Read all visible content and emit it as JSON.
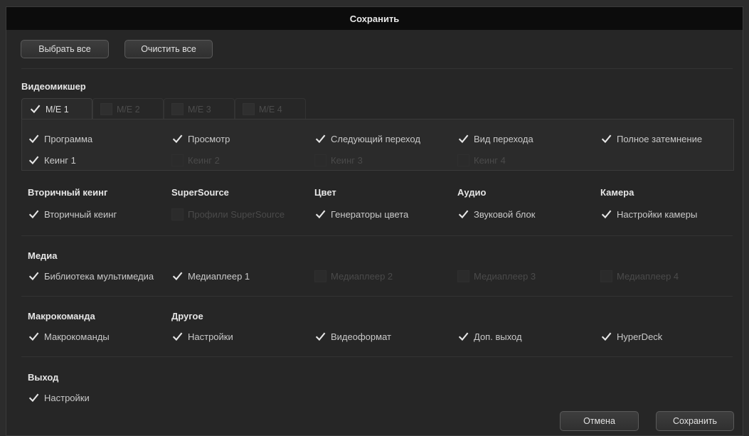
{
  "dialog": {
    "title": "Сохранить"
  },
  "toolbar": {
    "select_all": "Выбрать все",
    "clear_all": "Очистить все"
  },
  "switcher": {
    "title": "Видеомикшер",
    "tabs": [
      {
        "label": "M/E 1",
        "checked": true,
        "active": true
      },
      {
        "label": "M/E 2",
        "checked": false,
        "active": false
      },
      {
        "label": "M/E 3",
        "checked": false,
        "active": false
      },
      {
        "label": "M/E 4",
        "checked": false,
        "active": false
      }
    ],
    "items": [
      {
        "label": "Программа",
        "checked": true
      },
      {
        "label": "Просмотр",
        "checked": true
      },
      {
        "label": "Следующий переход",
        "checked": true
      },
      {
        "label": "Вид перехода",
        "checked": true
      },
      {
        "label": "Полное затемнение",
        "checked": true
      },
      {
        "label": "Кеинг 1",
        "checked": true
      },
      {
        "label": "Кеинг 2",
        "checked": false
      },
      {
        "label": "Кеинг 3",
        "checked": false
      },
      {
        "label": "Кеинг 4",
        "checked": false
      }
    ]
  },
  "groups": {
    "downstream_key": {
      "title": "Вторичный кеинг",
      "item": {
        "label": "Вторичный кеинг",
        "checked": true
      }
    },
    "supersource": {
      "title": "SuperSource",
      "item": {
        "label": "Профили SuperSource",
        "checked": false
      }
    },
    "color": {
      "title": "Цвет",
      "item": {
        "label": "Генераторы цвета",
        "checked": true
      }
    },
    "audio": {
      "title": "Аудио",
      "item": {
        "label": "Звуковой блок",
        "checked": true
      }
    },
    "camera": {
      "title": "Камера",
      "item": {
        "label": "Настройки камеры",
        "checked": true
      }
    }
  },
  "media": {
    "title": "Медиа",
    "items": [
      {
        "label": "Библиотека мультимедиа",
        "checked": true
      },
      {
        "label": "Медиаплеер 1",
        "checked": true
      },
      {
        "label": "Медиаплеер 2",
        "checked": false
      },
      {
        "label": "Медиаплеер 3",
        "checked": false
      },
      {
        "label": "Медиаплеер 4",
        "checked": false
      }
    ]
  },
  "macro": {
    "title": "Макрокоманда",
    "item": {
      "label": "Макрокоманды",
      "checked": true
    }
  },
  "other": {
    "title": "Другое",
    "items": [
      {
        "label": "Настройки",
        "checked": true
      },
      {
        "label": "Видеоформат",
        "checked": true
      },
      {
        "label": "Доп. выход",
        "checked": true
      },
      {
        "label": "HyperDeck",
        "checked": true
      }
    ]
  },
  "output": {
    "title": "Выход",
    "item": {
      "label": "Настройки",
      "checked": true
    }
  },
  "footer": {
    "cancel": "Отмена",
    "save": "Сохранить"
  },
  "colors": {
    "background": "#262626",
    "titlebar": "#0c0c0c",
    "checkmark": "#e6e6e6",
    "disabled_text": "#4a4a4a"
  }
}
